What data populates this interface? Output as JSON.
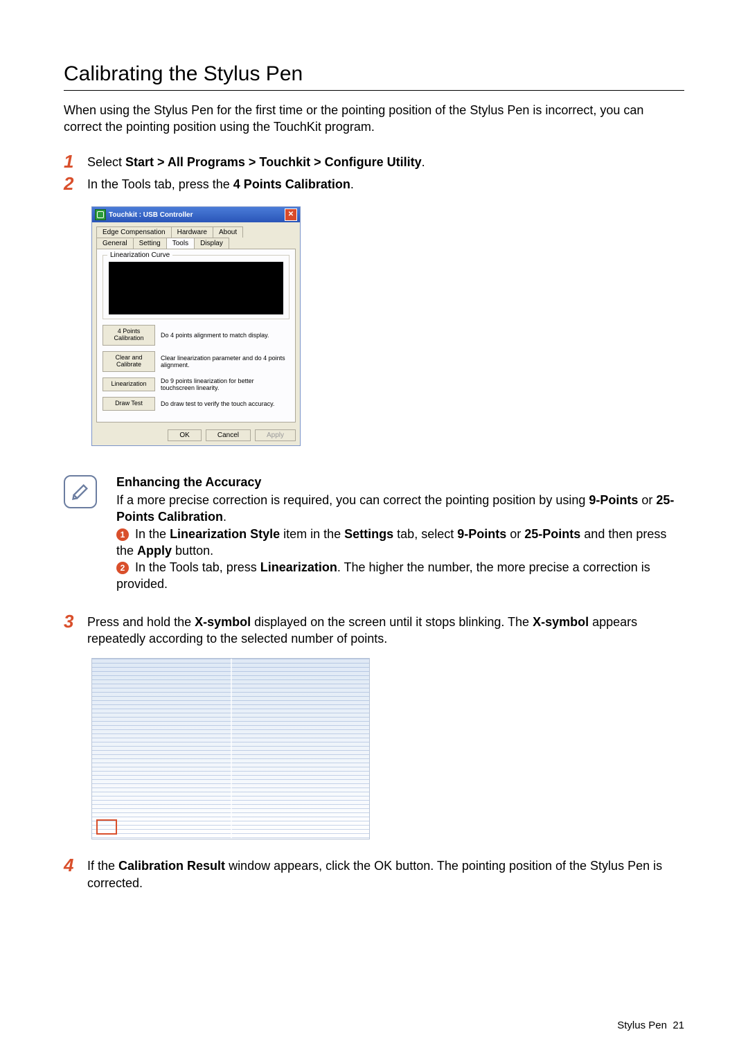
{
  "title": "Calibrating the Stylus Pen",
  "intro": "When using the Stylus Pen for the first time or the pointing position of the Stylus Pen is incorrect, you can correct the pointing position using the TouchKit program.",
  "steps": {
    "s1_pre": "Select ",
    "s1_b1": "Start > All Programs > Touchkit > Configure Utility",
    "s1_post": ".",
    "s2_pre": "In the Tools tab, press the ",
    "s2_b": "4 Points Calibration",
    "s2_post": ".",
    "s3_a": "Press and hold the ",
    "s3_b1": "X-symbol",
    "s3_mid": " displayed on the screen until it stops blinking. The ",
    "s3_b2": "X-symbol",
    "s3_end": " appears repeatedly according to the selected number of points.",
    "s4_a": "If the ",
    "s4_b": "Calibration Result",
    "s4_end": " window appears, click the OK button. The pointing position of the Stylus Pen is corrected."
  },
  "dialog": {
    "title": "Touchkit : USB Controller",
    "tabs_row1": [
      "Edge Compensation",
      "Hardware",
      "About"
    ],
    "tabs_row2": [
      "General",
      "Setting",
      "Tools",
      "Display"
    ],
    "group": "Linearization Curve",
    "btns": {
      "b1": {
        "label": "4 Points Calibration",
        "desc": "Do 4 points alignment to match display."
      },
      "b2": {
        "label": "Clear and Calibrate",
        "desc": "Clear linearization parameter and do 4 points alignment."
      },
      "b3": {
        "label": "Linearization",
        "desc": "Do 9 points linearization for better touchscreen linearity."
      },
      "b4": {
        "label": "Draw Test",
        "desc": "Do draw test to verify the touch accuracy."
      }
    },
    "ok": "OK",
    "cancel": "Cancel",
    "apply": "Apply"
  },
  "note": {
    "heading": "Enhancing the Accuracy",
    "p1a": "If a more precise correction is required, you can correct the pointing position by using ",
    "p1b1": "9-Points",
    "p1mid": " or ",
    "p1b2": "25-Points Calibration",
    "p1end": ".",
    "l1a": "In the ",
    "l1b1": "Linearization Style",
    "l1mid1": " item in the ",
    "l1b2": "Settings",
    "l1mid2": " tab, select ",
    "l1b3": "9-Points",
    "l1mid3": " or ",
    "l1b4": "25-Points",
    "l1mid4": " and then press the ",
    "l1b5": "Apply",
    "l1end": " button.",
    "l2a": "In the Tools tab, press ",
    "l2b": "Linearization",
    "l2end": ". The higher the number, the more precise a correction is provided."
  },
  "footer": {
    "label": "Stylus Pen",
    "page": "21"
  }
}
